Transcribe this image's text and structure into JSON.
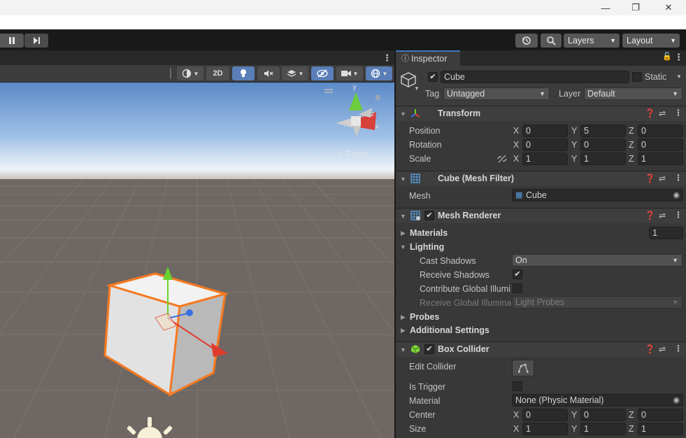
{
  "window": {
    "minimize": "—",
    "restore": "❐",
    "close": "✕"
  },
  "toolbar": {
    "pause_icon": "pause-icon",
    "step_icon": "step-icon",
    "history_icon": "history-icon",
    "search_icon": "search-icon",
    "layers_label": "Layers",
    "layout_label": "Layout"
  },
  "scene": {
    "btn_2d": "2D",
    "persp_label": "Persp",
    "gizmo_y": "y",
    "gizmo_z": "z",
    "gizmo_x": "x"
  },
  "inspector": {
    "tab_label": "Inspector",
    "object_name": "Cube",
    "static_label": "Static",
    "tag_label": "Tag",
    "tag_value": "Untagged",
    "layer_label": "Layer",
    "layer_value": "Default",
    "transform": {
      "title": "Transform",
      "position_label": "Position",
      "rotation_label": "Rotation",
      "scale_label": "Scale",
      "position": {
        "x": "0",
        "y": "5",
        "z": "0"
      },
      "rotation": {
        "x": "0",
        "y": "0",
        "z": "0"
      },
      "scale": {
        "x": "1",
        "y": "1",
        "z": "1"
      },
      "axis_x": "X",
      "axis_y": "Y",
      "axis_z": "Z"
    },
    "mesh_filter": {
      "title": "Cube (Mesh Filter)",
      "mesh_label": "Mesh",
      "mesh_value": "Cube"
    },
    "mesh_renderer": {
      "title": "Mesh Renderer",
      "materials_label": "Materials",
      "materials_count": "1",
      "lighting_label": "Lighting",
      "cast_shadows_label": "Cast Shadows",
      "cast_shadows_value": "On",
      "receive_shadows_label": "Receive Shadows",
      "contribute_gi_label": "Contribute Global Illumi",
      "receive_gi_label": "Receive Global Illumina",
      "receive_gi_value": "Light Probes",
      "probes_label": "Probes",
      "additional_label": "Additional Settings"
    },
    "box_collider": {
      "title": "Box Collider",
      "edit_collider_label": "Edit Collider",
      "is_trigger_label": "Is Trigger",
      "material_label": "Material",
      "material_value": "None (Physic Material)",
      "center_label": "Center",
      "size_label": "Size",
      "center": {
        "x": "0",
        "y": "0",
        "z": "0"
      },
      "size": {
        "x": "1",
        "y": "1",
        "z": "1"
      }
    }
  },
  "colors": {
    "accent": "#3a79bb",
    "selection": "#f57a22",
    "axis_x": "#e03b2f",
    "axis_y": "#6ad22c",
    "axis_z": "#3a6fe0"
  }
}
